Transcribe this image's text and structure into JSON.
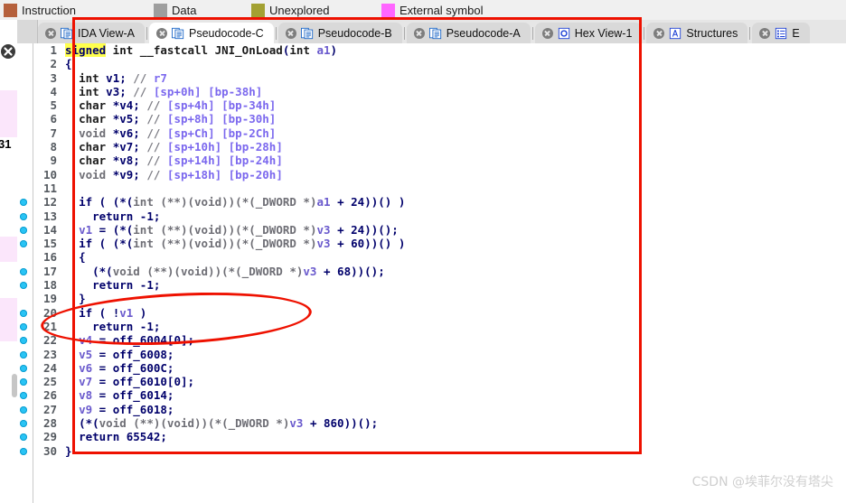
{
  "legend": {
    "items": [
      {
        "label": "Instruction",
        "color": "#b5603c"
      },
      {
        "label": "Data",
        "color": "#9e9e9e"
      },
      {
        "label": "Unexplored",
        "color": "#a3a132"
      },
      {
        "label": "External symbol",
        "color": "#ff66ff"
      }
    ]
  },
  "tabs": [
    {
      "label": "IDA View-A",
      "icon": "document-pages-icon",
      "active": false
    },
    {
      "label": "Pseudocode-C",
      "icon": "document-pages-icon",
      "active": true
    },
    {
      "label": "Pseudocode-B",
      "icon": "document-pages-icon",
      "active": false
    },
    {
      "label": "Pseudocode-A",
      "icon": "document-pages-icon",
      "active": false
    },
    {
      "label": "Hex View-1",
      "icon": "hex-view-icon",
      "active": false
    },
    {
      "label": "Structures",
      "icon": "structures-icon",
      "active": false
    },
    {
      "label": "E",
      "icon": "enums-icon",
      "active": false
    }
  ],
  "navigator": {
    "address_label": "31"
  },
  "annotations": {
    "rect_color": "#ee1100",
    "ellipse_color": "#ee1100"
  },
  "watermark": "CSDN @埃菲尔没有塔尖",
  "code": {
    "language": "c",
    "lines": [
      {
        "n": 1,
        "bp": false,
        "html": "<span class=\"hl\">signed</span><span class=\"typ\"> int </span><span class=\"fn\">__fastcall JNI_OnLoad</span><span class=\"kw\">(</span><span class=\"typ\">int </span><span class=\"var\">a1</span><span class=\"kw\">)</span>"
      },
      {
        "n": 2,
        "bp": false,
        "html": "<span class=\"kw\">{</span>"
      },
      {
        "n": 3,
        "bp": false,
        "html": "  <span class=\"typ\">int </span><span class=\"kw\">v1;</span> <span class=\"cmt\">// </span><span class=\"loc\">r7</span>"
      },
      {
        "n": 4,
        "bp": false,
        "html": "  <span class=\"typ\">int </span><span class=\"kw\">v3;</span> <span class=\"cmt\">// </span><span class=\"loc\">[sp+0h] [bp-38h]</span>"
      },
      {
        "n": 5,
        "bp": false,
        "html": "  <span class=\"typ\">char </span><span class=\"kw\">*v4;</span> <span class=\"cmt\">// </span><span class=\"loc\">[sp+4h] [bp-34h]</span>"
      },
      {
        "n": 6,
        "bp": false,
        "html": "  <span class=\"typ\">char </span><span class=\"kw\">*v5;</span> <span class=\"cmt\">// </span><span class=\"loc\">[sp+8h] [bp-30h]</span>"
      },
      {
        "n": 7,
        "bp": false,
        "html": "  <span class=\"dim\">void </span><span class=\"kw\">*v6;</span> <span class=\"cmt\">// </span><span class=\"loc\">[sp+Ch] [bp-2Ch]</span>"
      },
      {
        "n": 8,
        "bp": false,
        "html": "  <span class=\"typ\">char </span><span class=\"kw\">*v7;</span> <span class=\"cmt\">// </span><span class=\"loc\">[sp+10h] [bp-28h]</span>"
      },
      {
        "n": 9,
        "bp": false,
        "html": "  <span class=\"typ\">char </span><span class=\"kw\">*v8;</span> <span class=\"cmt\">// </span><span class=\"loc\">[sp+14h] [bp-24h]</span>"
      },
      {
        "n": 10,
        "bp": false,
        "html": "  <span class=\"dim\">void </span><span class=\"kw\">*v9;</span> <span class=\"cmt\">// </span><span class=\"loc\">[sp+18h] [bp-20h]</span>"
      },
      {
        "n": 11,
        "bp": false,
        "html": ""
      },
      {
        "n": 12,
        "bp": true,
        "html": "  <span class=\"kw\">if ( (*(</span><span class=\"dim\">int (**)(void))(*(_DWORD *)</span><span class=\"var\">a1</span><span class=\"kw\"> + </span><span class=\"num\">24</span><span class=\"kw\">))() )</span>"
      },
      {
        "n": 13,
        "bp": true,
        "html": "    <span class=\"kw\">return -1;</span>"
      },
      {
        "n": 14,
        "bp": true,
        "html": "  <span class=\"var\">v1</span><span class=\"kw\"> = (*(</span><span class=\"dim\">int (**)(void))(*(_DWORD *)</span><span class=\"var\">v3</span><span class=\"kw\"> + </span><span class=\"num\">24</span><span class=\"kw\">))();</span>"
      },
      {
        "n": 15,
        "bp": true,
        "html": "  <span class=\"kw\">if ( (*(</span><span class=\"dim\">int (**)(void))(*(_DWORD *)</span><span class=\"var\">v3</span><span class=\"kw\"> + </span><span class=\"num\">60</span><span class=\"kw\">))() )</span>"
      },
      {
        "n": 16,
        "bp": false,
        "html": "  <span class=\"kw\">{</span>"
      },
      {
        "n": 17,
        "bp": true,
        "html": "    <span class=\"kw\">(*(</span><span class=\"dim\">void (**)(void))(*(_DWORD *)</span><span class=\"var\">v3</span><span class=\"kw\"> + </span><span class=\"num\">68</span><span class=\"kw\">))();</span>"
      },
      {
        "n": 18,
        "bp": true,
        "html": "    <span class=\"kw\">return -1;</span>"
      },
      {
        "n": 19,
        "bp": false,
        "html": "  <span class=\"kw\">}</span>"
      },
      {
        "n": 20,
        "bp": true,
        "html": "  <span class=\"kw\">if ( !</span><span class=\"var\">v1</span><span class=\"kw\"> )</span>"
      },
      {
        "n": 21,
        "bp": true,
        "html": "    <span class=\"kw\">return -1;</span>"
      },
      {
        "n": 22,
        "bp": true,
        "html": "  <span class=\"var\">v4</span><span class=\"kw\"> = </span><span class=\"glb\">off_6004</span><span class=\"kw\">[</span><span class=\"num\">0</span><span class=\"kw\">];</span>"
      },
      {
        "n": 23,
        "bp": true,
        "html": "  <span class=\"var\">v5</span><span class=\"kw\"> = </span><span class=\"glb\">off_6008</span><span class=\"kw\">;</span>"
      },
      {
        "n": 24,
        "bp": true,
        "html": "  <span class=\"var\">v6</span><span class=\"kw\"> = </span><span class=\"glb\">off_600C</span><span class=\"kw\">;</span>"
      },
      {
        "n": 25,
        "bp": true,
        "html": "  <span class=\"var\">v7</span><span class=\"kw\"> = </span><span class=\"glb\">off_6010</span><span class=\"kw\">[</span><span class=\"num\">0</span><span class=\"kw\">];</span>"
      },
      {
        "n": 26,
        "bp": true,
        "html": "  <span class=\"var\">v8</span><span class=\"kw\"> = </span><span class=\"glb\">off_6014</span><span class=\"kw\">;</span>"
      },
      {
        "n": 27,
        "bp": true,
        "html": "  <span class=\"var\">v9</span><span class=\"kw\"> = </span><span class=\"glb\">off_6018</span><span class=\"kw\">;</span>"
      },
      {
        "n": 28,
        "bp": true,
        "html": "  <span class=\"kw\">(*(</span><span class=\"dim\">void (**)(void))(*(_DWORD *)</span><span class=\"var\">v3</span><span class=\"kw\"> + </span><span class=\"num\">860</span><span class=\"kw\">))();</span>"
      },
      {
        "n": 29,
        "bp": true,
        "html": "  <span class=\"kw\">return </span><span class=\"num\">65542</span><span class=\"kw\">;</span>"
      },
      {
        "n": 30,
        "bp": true,
        "html": "<span class=\"kw\">}</span>"
      }
    ]
  }
}
